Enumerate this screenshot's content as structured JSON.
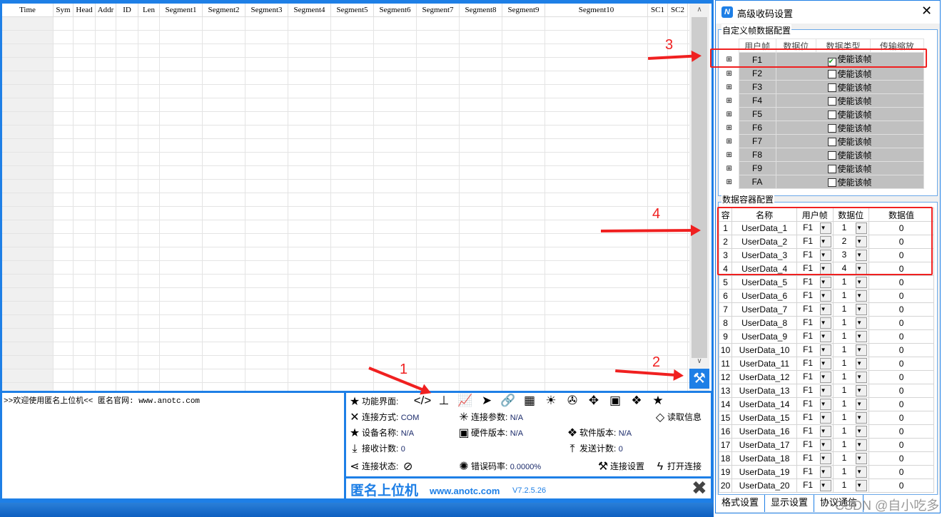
{
  "grid": {
    "columns": [
      "Time",
      "Sym",
      "Head",
      "Addr",
      "ID",
      "Len",
      "Segment1",
      "Segment2",
      "Segment3",
      "Segment4",
      "Segment5",
      "Segment6",
      "Segment7",
      "Segment8",
      "Segment9",
      "Segment10",
      "SC1",
      "SC2"
    ]
  },
  "log": {
    "text": ">>欢迎使用匿名上位机<<   匿名官网: www.anotc.com"
  },
  "info": {
    "func_label": "功能界面:",
    "conn_mode_label": "连接方式:",
    "conn_mode": "COM",
    "conn_param_label": "连接参数:",
    "conn_param": "N/A",
    "read_info": "读取信息",
    "device_label": "设备名称:",
    "device": "N/A",
    "hw_label": "硬件版本:",
    "hw": "N/A",
    "sw_label": "软件版本:",
    "sw": "N/A",
    "rx_label": "接收计数:",
    "rx": "0",
    "tx_label": "发送计数:",
    "tx": "0",
    "status_label": "连接状态:",
    "err_label": "错误码率:",
    "err": "0.0000%",
    "conn_settings": "连接设置",
    "open_conn": "打开连接"
  },
  "brand": {
    "name": "匿名上位机",
    "url": "www.anotc.com",
    "version": "V7.2.5.26"
  },
  "dialog": {
    "title": "高级收码设置",
    "group1": "自定义帧数据配置",
    "frame_headers": [
      "用户帧",
      "数据位",
      "数据类型",
      "传输缩放"
    ],
    "enable_label": "使能该帧",
    "frames": [
      {
        "id": "F1",
        "enabled": true
      },
      {
        "id": "F2",
        "enabled": false
      },
      {
        "id": "F3",
        "enabled": false
      },
      {
        "id": "F4",
        "enabled": false
      },
      {
        "id": "F5",
        "enabled": false
      },
      {
        "id": "F6",
        "enabled": false
      },
      {
        "id": "F7",
        "enabled": false
      },
      {
        "id": "F8",
        "enabled": false
      },
      {
        "id": "F9",
        "enabled": false
      },
      {
        "id": "FA",
        "enabled": false
      }
    ],
    "group2": "数据容器配置",
    "container_headers": [
      "容",
      "名称",
      "用户帧",
      "数据位",
      "数据值"
    ],
    "containers": [
      {
        "n": "1",
        "name": "UserData_1",
        "frame": "F1",
        "bit": "1",
        "value": "0"
      },
      {
        "n": "2",
        "name": "UserData_2",
        "frame": "F1",
        "bit": "2",
        "value": "0"
      },
      {
        "n": "3",
        "name": "UserData_3",
        "frame": "F1",
        "bit": "3",
        "value": "0"
      },
      {
        "n": "4",
        "name": "UserData_4",
        "frame": "F1",
        "bit": "4",
        "value": "0"
      },
      {
        "n": "5",
        "name": "UserData_5",
        "frame": "F1",
        "bit": "1",
        "value": "0"
      },
      {
        "n": "6",
        "name": "UserData_6",
        "frame": "F1",
        "bit": "1",
        "value": "0"
      },
      {
        "n": "7",
        "name": "UserData_7",
        "frame": "F1",
        "bit": "1",
        "value": "0"
      },
      {
        "n": "8",
        "name": "UserData_8",
        "frame": "F1",
        "bit": "1",
        "value": "0"
      },
      {
        "n": "9",
        "name": "UserData_9",
        "frame": "F1",
        "bit": "1",
        "value": "0"
      },
      {
        "n": "10",
        "name": "UserData_10",
        "frame": "F1",
        "bit": "1",
        "value": "0"
      },
      {
        "n": "11",
        "name": "UserData_11",
        "frame": "F1",
        "bit": "1",
        "value": "0"
      },
      {
        "n": "12",
        "name": "UserData_12",
        "frame": "F1",
        "bit": "1",
        "value": "0"
      },
      {
        "n": "13",
        "name": "UserData_13",
        "frame": "F1",
        "bit": "1",
        "value": "0"
      },
      {
        "n": "14",
        "name": "UserData_14",
        "frame": "F1",
        "bit": "1",
        "value": "0"
      },
      {
        "n": "15",
        "name": "UserData_15",
        "frame": "F1",
        "bit": "1",
        "value": "0"
      },
      {
        "n": "16",
        "name": "UserData_16",
        "frame": "F1",
        "bit": "1",
        "value": "0"
      },
      {
        "n": "17",
        "name": "UserData_17",
        "frame": "F1",
        "bit": "1",
        "value": "0"
      },
      {
        "n": "18",
        "name": "UserData_18",
        "frame": "F1",
        "bit": "1",
        "value": "0"
      },
      {
        "n": "19",
        "name": "UserData_19",
        "frame": "F1",
        "bit": "1",
        "value": "0"
      },
      {
        "n": "20",
        "name": "UserData_20",
        "frame": "F1",
        "bit": "1",
        "value": "0"
      }
    ],
    "tabs": [
      "格式设置",
      "显示设置",
      "协议通信"
    ]
  },
  "annotations": [
    "1",
    "2",
    "3",
    "4"
  ],
  "watermark": "CSDN @自小吃多",
  "colors": {
    "frame_blue": "#1e7fe6",
    "annotation_red": "#f02020",
    "brand_blue": "#1e7fe6"
  }
}
